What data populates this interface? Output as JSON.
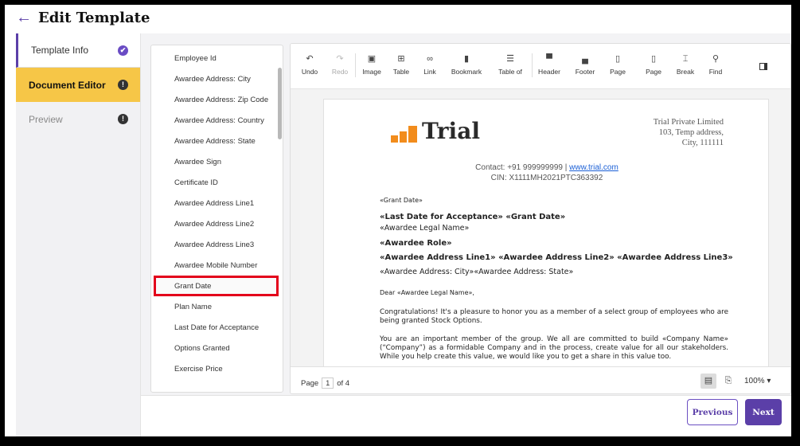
{
  "header": {
    "back_icon": "arrow-left-icon",
    "title": "Edit Template"
  },
  "steps": [
    {
      "label": "Template Info",
      "status": "complete",
      "status_glyph": "✔"
    },
    {
      "label": "Document Editor",
      "status": "warning",
      "status_glyph": "!"
    },
    {
      "label": "Preview",
      "status": "warning",
      "status_glyph": "!"
    }
  ],
  "fields": {
    "items": [
      "Employee Id",
      "Awardee Address: City",
      "Awardee Address: Zip Code",
      "Awardee Address: Country",
      "Awardee Address: State",
      "Awardee Sign",
      "Certificate ID",
      "Awardee Address Line1",
      "Awardee Address Line2",
      "Awardee Address Line3",
      "Awardee Mobile Number",
      "Grant Date",
      "Plan Name",
      "Last Date for Acceptance",
      "Options Granted",
      "Exercise Price"
    ],
    "selected": "Grant Date"
  },
  "toolbar": {
    "undo": "Undo",
    "redo": "Redo",
    "image": "Image",
    "table": "Table",
    "link": "Link",
    "bookmark": "Bookmark",
    "table_of": "Table of",
    "header": "Header",
    "footer": "Footer",
    "page_number": "Page",
    "page_break": "Page",
    "break": "Break",
    "find": "Find"
  },
  "document": {
    "logo_text": "Trial",
    "company_name": "Trial Private Limited",
    "company_address_1": "103, Temp address,",
    "company_address_2": "City, 111111",
    "contact_prefix": "Contact: +91 999999999 | ",
    "contact_link": "www.trial.com",
    "cin": "CIN: X1111MH2021PTC363392",
    "line_grant_date": "«Grant Date»",
    "line_acceptance": "«Last Date for Acceptance»   «Grant Date»",
    "line_legal_name": "«Awardee Legal Name»",
    "line_role": "«Awardee Role»",
    "line_address": "«Awardee Address Line1»  «Awardee Address Line2» «Awardee Address Line3»",
    "line_city_state": "«Awardee Address: City»«Awardee Address: State»",
    "salutation": "Dear «Awardee Legal Name»,",
    "para_1": "Congratulations!  It's a pleasure to honor you as a member of a select group of employees who are being granted Stock Options.",
    "para_2": "You are an important member of the group. We all are committed to build «Company Name» (“Company”) as a formidable Company and in the process, create value for all our stakeholders. While you help create this value, we would like you to get a share in this value too."
  },
  "footer": {
    "page_label": "Page",
    "current_page": "1",
    "of_label": "of 4",
    "zoom": "100%"
  },
  "actions": {
    "previous": "Previous",
    "next": "Next"
  },
  "colors": {
    "accent": "#5b3fa8",
    "active_step": "#f6c647",
    "highlight": "#e3001b",
    "logo_orange": "#f28c1c"
  }
}
